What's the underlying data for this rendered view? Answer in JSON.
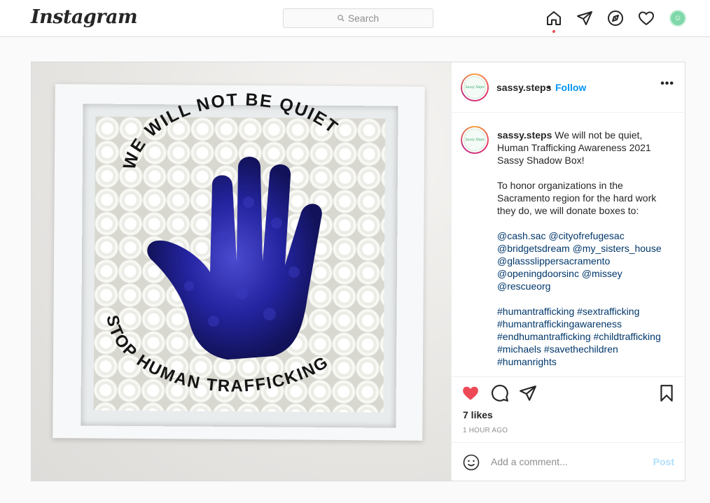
{
  "app": {
    "logo": "Instagram"
  },
  "search": {
    "placeholder": "Search"
  },
  "nav": {
    "icons": [
      "home-icon",
      "direct-icon",
      "explore-icon",
      "activity-icon",
      "profile-avatar"
    ]
  },
  "post": {
    "username": "sassy.steps",
    "separator": "•",
    "follow_label": "Follow",
    "more_label": "•••",
    "avatar_text": "Sassy Steps",
    "caption": {
      "username": "sassy.steps",
      "line1": "We will not be quiet, Human Trafficking Awareness 2021 Sassy Shadow Box!",
      "para2": "To honor organizations in the Sacramento region for the hard work they do, we will donate boxes to:",
      "mentions": "@cash.sac @cityofrefugesac @bridgetsdream @my_sisters_house @glassslippersacramento @openingdoorsinc @missey @rescueorg",
      "hashtags": "#humantrafficking #sextrafficking #humantraffickingawareness #endhumantrafficking #childtrafficking #michaels #savethechildren #humanrights"
    },
    "image_text": {
      "top": "WE WILL NOT BE QUIET",
      "bottom": "STOP HUMAN TRAFFICKING"
    },
    "liked": true,
    "likes_text": "7 likes",
    "time_text": "1 HOUR AGO",
    "comment_placeholder": "Add a comment...",
    "post_button": "Post"
  },
  "colors": {
    "accent": "#0095f6",
    "like": "#ed4956",
    "hand": "#2a2aa6"
  }
}
